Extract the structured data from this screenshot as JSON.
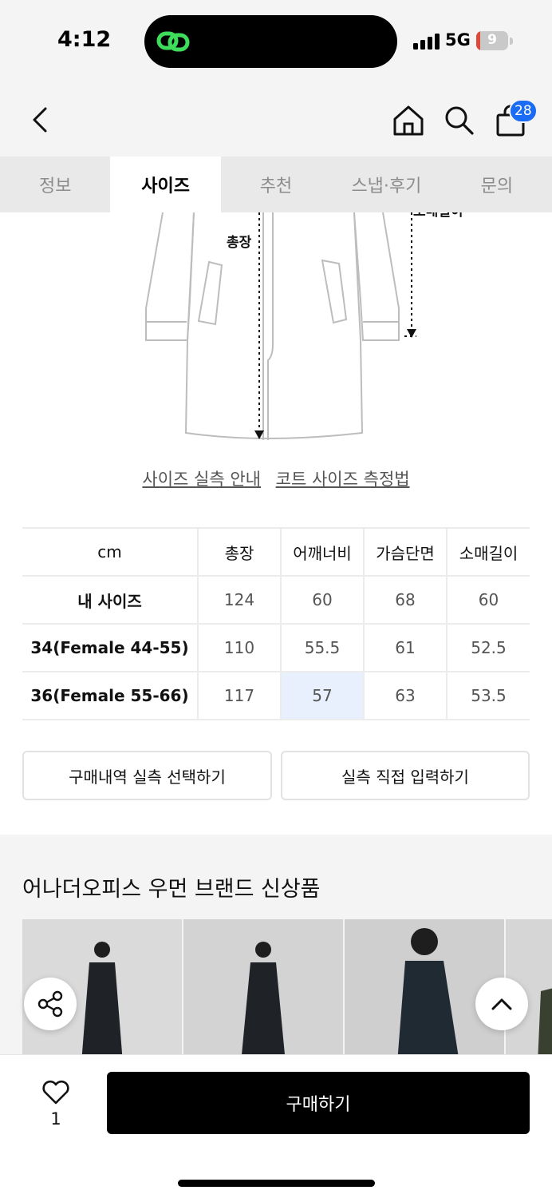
{
  "status_bar": {
    "time": "4:12",
    "network": "5G",
    "battery": "9",
    "battery_level": 0.09
  },
  "header": {
    "back_icon": "chevron-left-icon",
    "home_icon": "home-icon",
    "search_icon": "search-icon",
    "cart_icon": "shopping-bag-icon",
    "cart_count": "28",
    "badge_color": "#1a6cf5"
  },
  "tabs": [
    {
      "label": "정보",
      "active": false
    },
    {
      "label": "사이즈",
      "active": true
    },
    {
      "label": "추천",
      "active": false
    },
    {
      "label": "스냅·후기",
      "active": false
    },
    {
      "label": "문의",
      "active": false
    }
  ],
  "diagram": {
    "length_label": "총장",
    "sleeve_label": "소매길이"
  },
  "links": {
    "guide": "사이즈 실측 안내",
    "method": "코트 사이즈 측정법"
  },
  "size_table": {
    "headers": [
      "cm",
      "총장",
      "어깨너비",
      "가슴단면",
      "소매길이"
    ],
    "rows": [
      [
        "내 사이즈",
        "124",
        "60",
        "68",
        "60"
      ],
      [
        "34(Female 44-55)",
        "110",
        "55.5",
        "61",
        "52.5"
      ],
      [
        "36(Female 55-66)",
        "117",
        "57",
        "63",
        "53.5"
      ]
    ],
    "highlight_color": "#e8f0fd"
  },
  "actions": {
    "purchase_history": "구매내역 실측 선택하기",
    "manual_input": "실측 직접 입력하기"
  },
  "recommendations": {
    "title": "어나더오피스 우먼 브랜드 신상품"
  },
  "floating": {
    "share_icon": "share-icon",
    "top_icon": "chevron-up-icon"
  },
  "bottom_bar": {
    "like_icon": "heart-icon",
    "like_count": "1",
    "buy_label": "구매하기"
  }
}
